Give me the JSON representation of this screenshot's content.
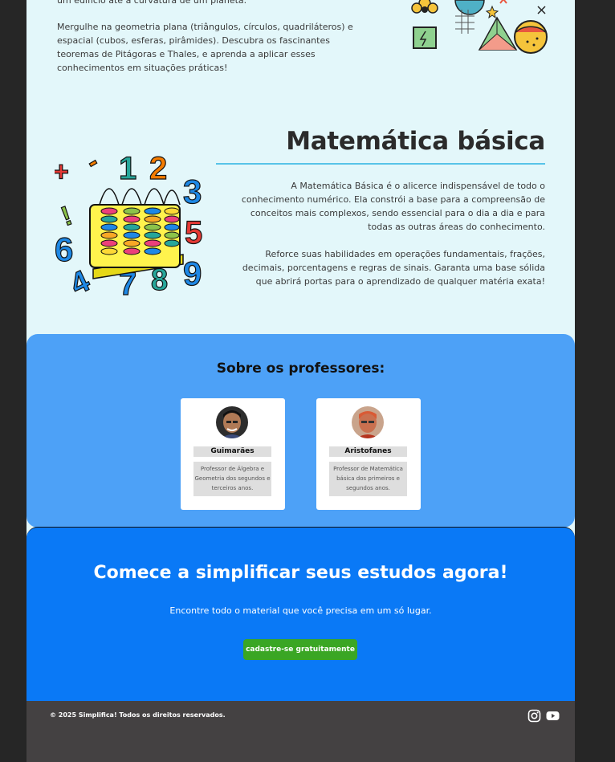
{
  "geometry": {
    "paragraphs": [
      "um edifício até a curvatura de um planeta.",
      "Mergulhe na geometria plana (triângulos, círculos, quadriláteros) e espacial (cubos, esferas, pirâmides). Descubra os fascinantes teoremas de Pitágoras e Thales, e aprenda a aplicar esses conhecimentos em situações práticas!"
    ]
  },
  "basic_math": {
    "title": "Matemática básica",
    "paragraphs": [
      "A Matemática Básica é o alicerce indispensável de todo o conhecimento numérico. Ela constrói a base para a compreensão de conceitos mais complexos, sendo essencial para o dia a dia e para todas as outras áreas do conhecimento.",
      "Reforce suas habilidades em operações fundamentais, frações, decimais, porcentagens e regras de sinais. Garanta uma base sólida que abrirá portas para o aprendizado de qualquer matéria exata!"
    ]
  },
  "teachers": {
    "title": "Sobre os professores:",
    "cards": [
      {
        "name": "Guimarães",
        "description": "Professor de Álgebra e Geometria dos segundos e terceiros anos."
      },
      {
        "name": "Aristofanes",
        "description": "Professor de Matemática básica dos primeiros e segundos anos."
      }
    ]
  },
  "cta": {
    "title": "Comece a simplificar seus estudos agora!",
    "subtitle": "Encontre todo o material que você precisa em um só lugar.",
    "button_label": "cadastre-se gratuitamente"
  },
  "footer": {
    "copyright": "© 2025 Simplifica! Todos os direitos reservados.",
    "social_icons": [
      "instagram-icon",
      "youtube-icon"
    ]
  },
  "colors": {
    "page_bg": "#e3f7fa",
    "teachers_bg": "#4da1f7",
    "cta_bg": "#0a79f6",
    "button_green": "#3aa624",
    "footer_bg": "#444142",
    "accent_rule": "#58c4e8"
  }
}
